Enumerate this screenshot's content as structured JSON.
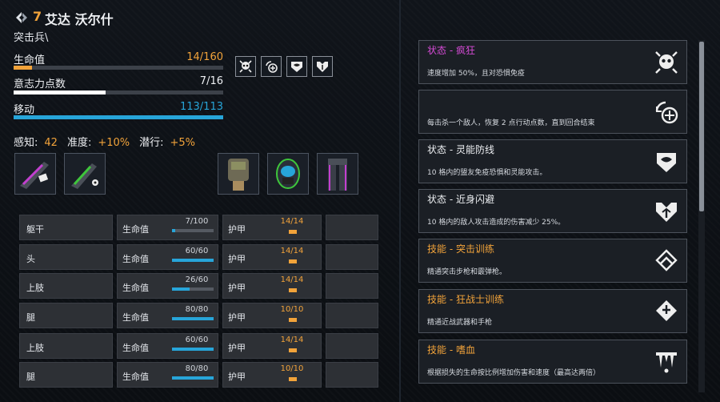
{
  "character": {
    "number": "7",
    "name": "艾达 沃尔什",
    "class": "突击兵\\"
  },
  "stats": {
    "health": {
      "label": "生命值",
      "value": "14/160",
      "fraction": 0.0875,
      "color": "#f2a33a"
    },
    "willpower": {
      "label": "意志力点数",
      "value": "7/16",
      "fraction": 0.4375,
      "color": "#ffffff"
    },
    "movement": {
      "label": "移动",
      "value": "113/113",
      "fraction": 1.0,
      "color": "#27a5d9"
    }
  },
  "status_icons": [
    "frenzy-skull-icon",
    "action-refill-icon",
    "psychic-shield-icon",
    "melee-evasion-icon"
  ],
  "attributes": [
    {
      "label": "感知:",
      "value": "42"
    },
    {
      "label": "准度:",
      "value": "+10%"
    },
    {
      "label": "潜行:",
      "value": "+5%"
    }
  ],
  "equipment": {
    "weapons": [
      "assault-rifle-icon",
      "handgun-icon"
    ],
    "armor": [
      "torso-armor-icon",
      "helmet-icon",
      "legs-armor-icon"
    ]
  },
  "body_parts": {
    "hp_label": "生命值",
    "armor_label": "护甲",
    "rows": [
      {
        "part": "躯干",
        "hp": "7/100",
        "hp_fraction": 0.07,
        "armor": "14/14"
      },
      {
        "part": "头",
        "hp": "60/60",
        "hp_fraction": 1.0,
        "armor": "14/14"
      },
      {
        "part": "上肢",
        "hp": "26/60",
        "hp_fraction": 0.43,
        "armor": "14/14"
      },
      {
        "part": "腿",
        "hp": "80/80",
        "hp_fraction": 1.0,
        "armor": "10/10"
      },
      {
        "part": "上肢",
        "hp": "60/60",
        "hp_fraction": 1.0,
        "armor": "14/14"
      },
      {
        "part": "腿",
        "hp": "80/80",
        "hp_fraction": 1.0,
        "armor": "10/10"
      }
    ]
  },
  "skills": [
    {
      "title": "状态 - 疯狂",
      "color": "#d64bd6",
      "desc": "速度增加 50%，且对恐惧免疫",
      "icon": "frenzy-skull-icon"
    },
    {
      "title": "",
      "color": "#eef0f3",
      "desc": "每击杀一个敌人，恢复 2 点行动点数，直到回合结束",
      "icon": "action-refill-icon"
    },
    {
      "title": "状态 - 灵能防线",
      "color": "#eef0f3",
      "desc": "10 格内的盟友免疫恐惧和灵能攻击。",
      "icon": "psychic-shield-icon"
    },
    {
      "title": "状态 - 近身闪避",
      "color": "#eef0f3",
      "desc": "10 格内的敌人攻击造成的伤害减少 25%。",
      "icon": "melee-evasion-icon"
    },
    {
      "title": "技能 - 突击训练",
      "color": "#f2a33a",
      "desc": "精通突击步枪和霰弹枪。",
      "icon": "assault-training-icon"
    },
    {
      "title": "技能 - 狂战士训练",
      "color": "#f2a33a",
      "desc": "精通近战武器和手枪",
      "icon": "berserker-training-icon"
    },
    {
      "title": "技能 - 嗜血",
      "color": "#f2a33a",
      "desc": "根据损失的生命按比例增加伤害和速度（最高达两倍）",
      "icon": "bloodlust-fang-icon"
    }
  ]
}
